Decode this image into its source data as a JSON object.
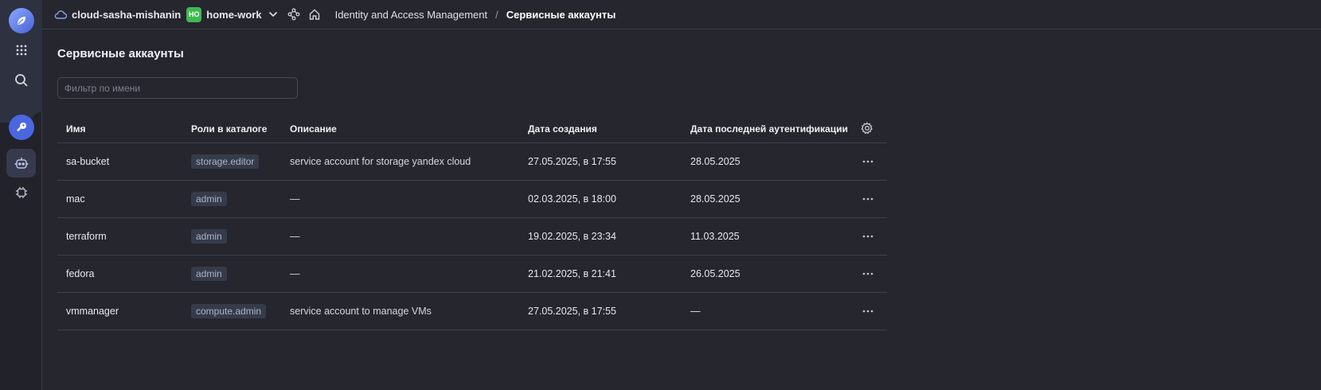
{
  "header": {
    "cloud_name": "cloud-sasha-mishanin",
    "folder_badge": "НО",
    "folder_name": "home-work",
    "crumb_service": "Identity and Access Management",
    "crumb_separator": "/",
    "crumb_current": "Сервисные аккаунты"
  },
  "page": {
    "title": "Сервисные аккаунты",
    "filter_placeholder": "Фильтр по имени"
  },
  "table": {
    "columns": {
      "name": "Имя",
      "roles": "Роли в каталоге",
      "description": "Описание",
      "created": "Дата создания",
      "last_auth": "Дата последней аутентификации"
    },
    "rows": [
      {
        "name": "sa-bucket",
        "role": "storage.editor",
        "description": "service account for storage yandex cloud",
        "created": "27.05.2025, в 17:55",
        "last_auth": "28.05.2025"
      },
      {
        "name": "mac",
        "role": "admin",
        "description": "—",
        "created": "02.03.2025, в 18:00",
        "last_auth": "28.05.2025"
      },
      {
        "name": "terraform",
        "role": "admin",
        "description": "—",
        "created": "19.02.2025, в 23:34",
        "last_auth": "11.03.2025"
      },
      {
        "name": "fedora",
        "role": "admin",
        "description": "—",
        "created": "21.02.2025, в 21:41",
        "last_auth": "26.05.2025"
      },
      {
        "name": "vmmanager",
        "role": "compute.admin",
        "description": "service account to manage VMs",
        "created": "27.05.2025, в 17:55",
        "last_auth": "—"
      }
    ]
  },
  "colors": {
    "background": "#26262e",
    "accent": "#4a67e0",
    "folder_badge": "#3fb950"
  },
  "icons": {
    "logo": "yandex-cloud-logo-icon",
    "services": "grid-dots-icon",
    "search": "search-icon",
    "iam": "key-icon",
    "service_accounts": "robot-icon",
    "other": "chip-icon",
    "cloud": "cloud-icon",
    "chevron": "chevron-down-icon",
    "nodes": "nodes-icon",
    "home": "home-icon",
    "settings": "gear-icon",
    "row_menu": "more-horizontal-icon"
  }
}
